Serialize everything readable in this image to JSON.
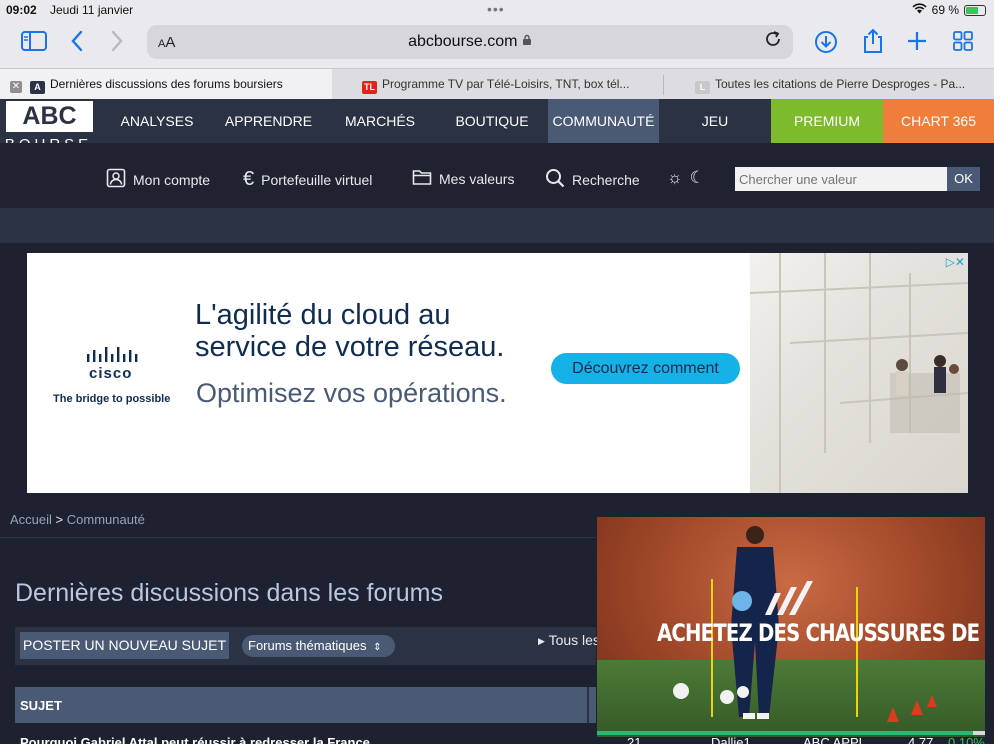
{
  "status": {
    "time": "09:02",
    "date": "Jeudi 11 janvier",
    "battery": "69 %",
    "battery_level": 0.69
  },
  "toolbar": {
    "text_size": "AA",
    "url": "abcbourse.com"
  },
  "tabs": [
    {
      "label": "Dernières discussions des forums boursiers",
      "active": true
    },
    {
      "label": "Programme TV par Télé-Loisirs, TNT, box tél...",
      "active": false
    },
    {
      "label": "Toutes les citations de Pierre Desproges - Pa...",
      "active": false
    }
  ],
  "site": {
    "logo_top": "ABC",
    "logo_bottom": "BOURSE",
    "nav": [
      "ANALYSES",
      "APPRENDRE",
      "MARCHÉS",
      "BOUTIQUE",
      "COMMUNAUTÉ",
      "JEU",
      "PREMIUM",
      "CHART 365"
    ],
    "subnav": {
      "account": "Mon compte",
      "portfolio": "Portefeuille virtuel",
      "values": "Mes valeurs",
      "search": "Recherche"
    },
    "search_placeholder": "Chercher une valeur",
    "ok": "OK"
  },
  "ad": {
    "brand": "cisco",
    "tagline": "The bridge to possible",
    "headline_1": "L'agilité du cloud au",
    "headline_2": "service de votre réseau.",
    "cta": "Découvrez comment",
    "subline": "Optimisez vos opérations."
  },
  "content": {
    "breadcrumb_home": "Accueil",
    "breadcrumb_sep": ">",
    "breadcrumb_current": "Communauté",
    "title": "Dernières discussions dans les forums",
    "post_button": "POSTER UN NOUVEAU SUJET",
    "forum_select": "Forums thématiques",
    "all_link": "Tous les",
    "table_header": "SUJET",
    "row": {
      "subject": "Pourquoi Gabriel Attal peut réussir à redresser la France",
      "count": "21",
      "user": "Dallie1",
      "fund": "ABC APPL",
      "price": "4.77",
      "change": "0.10%"
    }
  },
  "video_ad": {
    "text": "ACHETEZ DES CHAUSSURES DE FOOTBALL",
    "progress": 0.97
  },
  "colors": {
    "accent": "#1a73e8",
    "premium": "#7dbb2d",
    "chart365": "#f07d3a",
    "nav_active": "#4a5a75",
    "page_bg": "#1e2130"
  }
}
